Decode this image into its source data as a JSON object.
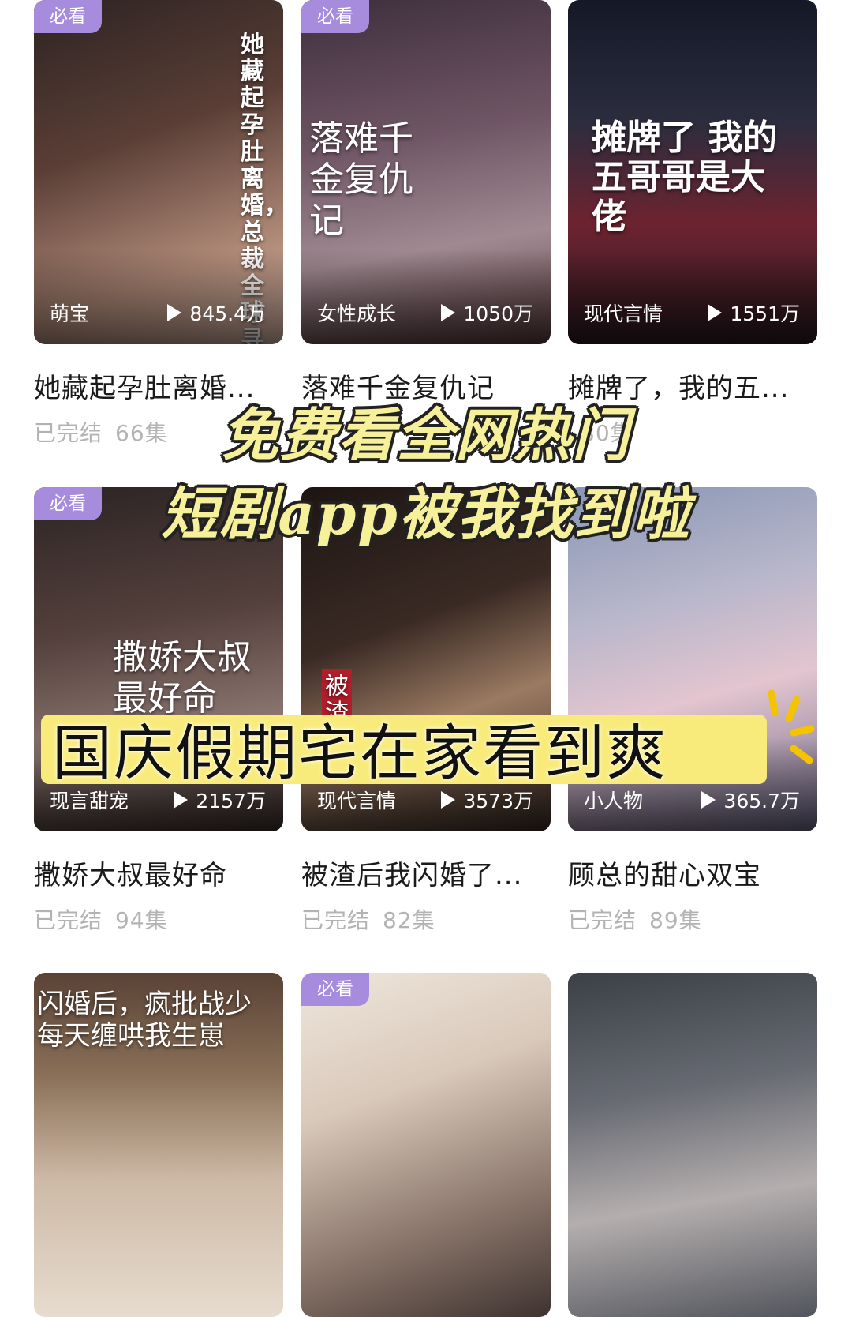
{
  "cards": [
    {
      "badge": "必看",
      "tag": "萌宝",
      "views": "845.4万",
      "title": "她藏起孕肚离婚...",
      "status": "已完结",
      "episodes": "66集",
      "poster_text": "她藏起孕肚离婚，总裁全球寻",
      "colors": [
        "#3c2b2a",
        "#a77d6c"
      ]
    },
    {
      "badge": "必看",
      "tag": "女性成长",
      "views": "1050万",
      "title": "落难千金复仇记",
      "status": "",
      "episodes": "",
      "poster_text": "落难千金复仇记",
      "colors": [
        "#5b4a56",
        "#a68a92"
      ]
    },
    {
      "badge": "",
      "tag": "现代言情",
      "views": "1551万",
      "title": "摊牌了，我的五...",
      "status": "",
      "episodes": "80集",
      "poster_text": "摊牌了 我的五哥哥是大佬",
      "colors": [
        "#1b1e2e",
        "#7b2a35"
      ]
    },
    {
      "badge": "必看",
      "tag": "现言甜宠",
      "views": "2157万",
      "title": "撒娇大叔最好命",
      "status": "已完结",
      "episodes": "94集",
      "poster_text": "撒娇大叔最好命",
      "colors": [
        "#3e2f2d",
        "#7c6662"
      ]
    },
    {
      "badge": "",
      "tag": "现代言情",
      "views": "3573万",
      "title": "被渣后我闪婚了...",
      "status": "已完结",
      "episodes": "82集",
      "poster_text": "被渣",
      "colors": [
        "#2a1f1c",
        "#8c6a55"
      ]
    },
    {
      "badge": "",
      "tag": "小人物",
      "views": "365.7万",
      "title": "顾总的甜心双宝",
      "status": "已完结",
      "episodes": "89集",
      "poster_text": "",
      "colors": [
        "#5e6b8c",
        "#c9a7b7"
      ]
    },
    {
      "badge": "",
      "tag": "",
      "views": "",
      "title": "",
      "status": "",
      "episodes": "",
      "poster_text": "闪婚后，疯批战少每天缠哄我生崽",
      "colors": [
        "#6b5244",
        "#cdb9a5"
      ]
    },
    {
      "badge": "必看",
      "tag": "",
      "views": "",
      "title": "",
      "status": "",
      "episodes": "",
      "poster_text": "",
      "colors": [
        "#e8ddd2",
        "#6e5a50"
      ]
    },
    {
      "badge": "",
      "tag": "",
      "views": "",
      "title": "",
      "status": "",
      "episodes": "",
      "poster_text": "",
      "colors": [
        "#4a4e55",
        "#a7a3a3"
      ]
    }
  ],
  "overlay": {
    "line1": "免费看全网热门",
    "line2": "短剧app被我找到啦",
    "banner": "国庆假期宅在家看到爽"
  },
  "colors": {
    "badge_bg": "#a78bdd",
    "headline": "#f6f09a",
    "banner_bg": "#f8eb7c"
  }
}
